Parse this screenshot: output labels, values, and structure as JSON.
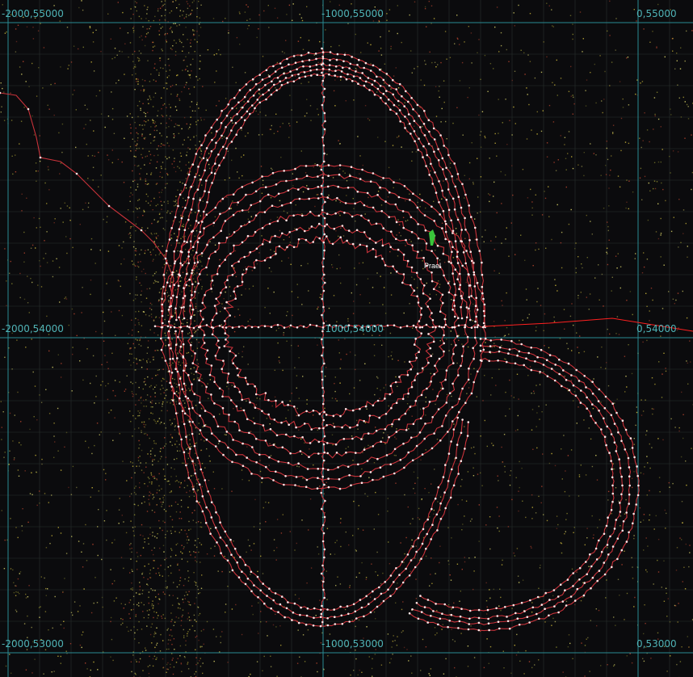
{
  "map": {
    "colors": {
      "background": "#0b0b0d",
      "grid_minor": "#2a2f2f",
      "grid_major": "#2a8b92",
      "track_line": "#c8323a",
      "track_point": "#ffe6e6",
      "speckle_colors": [
        "#c9b53a",
        "#b8452f",
        "#8c8a30",
        "#d9d36a"
      ],
      "heading_line": "#ff2020",
      "marker": "#39c43a"
    },
    "coordinates": {
      "top_left": "-2000,55000",
      "top_center": "-1000,55000",
      "top_right": "0,55000",
      "mid_left": "-2000,54000",
      "mid_center": "-1000,54000",
      "mid_right": "0,54000",
      "bottom_left": "-2000,53000",
      "bottom_center": "-1000,53000",
      "bottom_right": "0,53000"
    },
    "marker": {
      "label": "Prael",
      "icon": "boat-marker-icon"
    }
  }
}
